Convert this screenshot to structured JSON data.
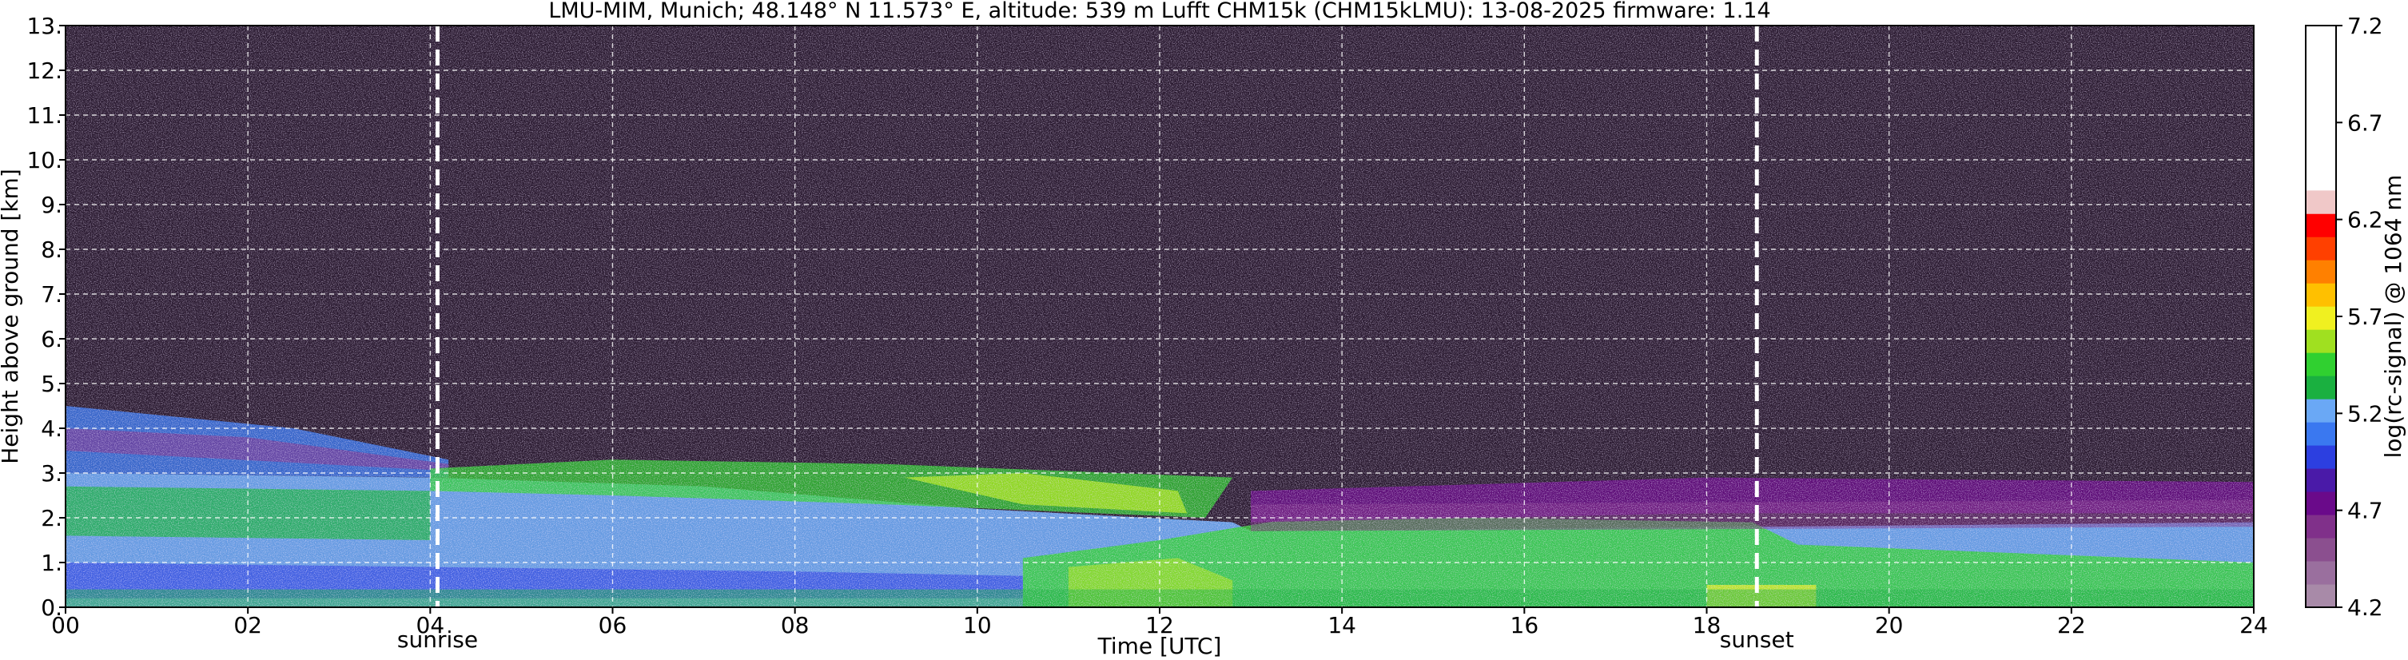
{
  "chart_data": {
    "type": "heatmap",
    "title": "LMU-MIM, Munich; 48.148° N 11.573° E, altitude: 539 m    Lufft CHM15k (CHM15kLMU): 13-08-2025    firmware: 1.14",
    "xlabel": "Time [UTC]",
    "ylabel": "Height above ground [km]",
    "colorbar_label": "log(rc-signal) @ 1064 nm",
    "xlim": [
      0,
      24
    ],
    "ylim": [
      0,
      13
    ],
    "x_ticks": [
      "00",
      "02",
      "04",
      "06",
      "08",
      "10",
      "12",
      "14",
      "16",
      "18",
      "20",
      "22",
      "24"
    ],
    "y_ticks": [
      "0.",
      "1.",
      "2.",
      "3.",
      "4.",
      "5.",
      "6.",
      "7.",
      "8.",
      "9.",
      "10.",
      "11.",
      "12.",
      "13."
    ],
    "colorbar_range": [
      4.2,
      7.2
    ],
    "colorbar_ticks": [
      "4.2",
      "4.7",
      "5.2",
      "5.7",
      "6.2",
      "6.7",
      "7.2"
    ],
    "grid": true,
    "markers": [
      {
        "label": "sunrise",
        "time": 4.08
      },
      {
        "label": "sunset",
        "time": 18.55
      }
    ],
    "colormap": [
      "#a88aa8",
      "#9a6f9e",
      "#8b4f8f",
      "#80308a",
      "#6a0a8a",
      "#4a1aa8",
      "#2c3fe0",
      "#3a78f0",
      "#6aa8f5",
      "#1ab040",
      "#30d030",
      "#a0e020",
      "#f0f020",
      "#ffc000",
      "#ff8000",
      "#ff4000",
      "#ff0000",
      "#f0c8c8",
      "#ffffff"
    ],
    "layers": [
      {
        "name": "upper-noise",
        "y0": 3.2,
        "y1": 13,
        "level": "low"
      },
      {
        "name": "residual-layer",
        "y0": 2.0,
        "y1": 3.3,
        "t0": 4,
        "t1": 12.8,
        "level": "high"
      },
      {
        "name": "aerosol-top-morning",
        "y0": 3.0,
        "y1": 4.6,
        "t0": 0,
        "t1": 4.2,
        "level": "mid"
      },
      {
        "name": "boundary-layer",
        "y0": 0,
        "y1": 2.0,
        "t0": 0,
        "t1": 24,
        "level": "mid-high"
      },
      {
        "name": "mixed-layer-afternoon",
        "y0": 0,
        "y1": 2.3,
        "t0": 10.5,
        "t1": 18.5,
        "level": "high"
      },
      {
        "name": "evening-layer",
        "y0": 1.9,
        "y1": 2.8,
        "t0": 13,
        "t1": 24,
        "level": "low-mid"
      }
    ]
  }
}
